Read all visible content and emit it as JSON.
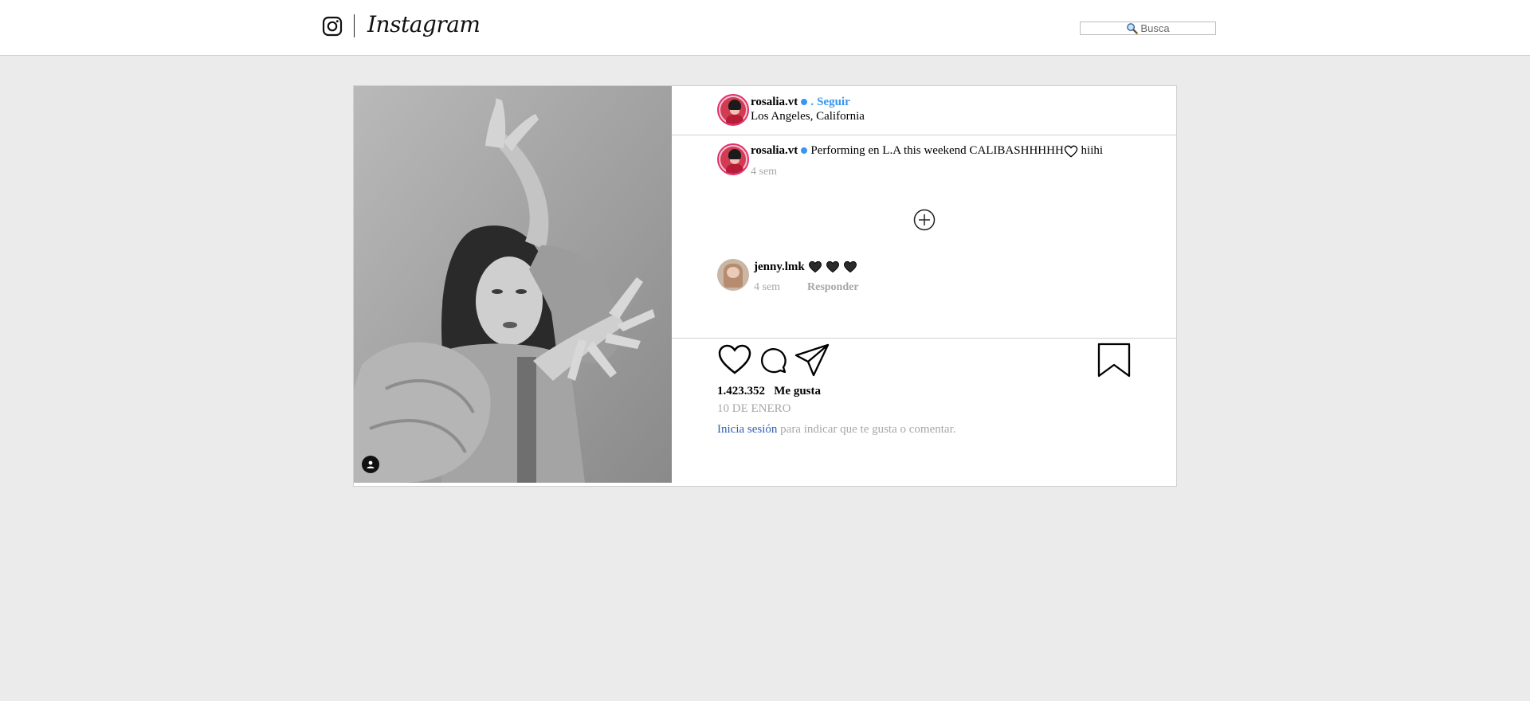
{
  "header": {
    "brand": "Instagram",
    "search_placeholder": "Busca"
  },
  "post": {
    "author": {
      "username": "rosalia.vt",
      "follow_separator": ".",
      "follow_label": "Seguir",
      "location": "Los Angeles, California"
    },
    "caption": {
      "username": "rosalia.vt",
      "text_before": "Performing en L.A this weekend CALIBASHHHHH",
      "text_after": " hiihi",
      "time": "4 sem"
    },
    "comments": [
      {
        "username": "jenny.lmk",
        "hearts": 3,
        "time": "4 sem",
        "reply_label": "Responder"
      }
    ],
    "likes_count": "1.423.352",
    "likes_label": "Me gusta",
    "date": "10 DE ENERO",
    "login_link": "Inicia sesión",
    "login_text": " para indicar que te gusta o comentar."
  },
  "icons": [
    "instagram-glyph-icon",
    "search-icon",
    "verified-icon",
    "add-comment-icon",
    "heart-icon",
    "comment-icon",
    "share-icon",
    "bookmark-icon",
    "user-tag-icon"
  ],
  "colors": {
    "background": "#ebebeb",
    "link_blue": "#3897f0",
    "login_blue": "#2f5fb3",
    "muted": "#a7a7a7"
  }
}
